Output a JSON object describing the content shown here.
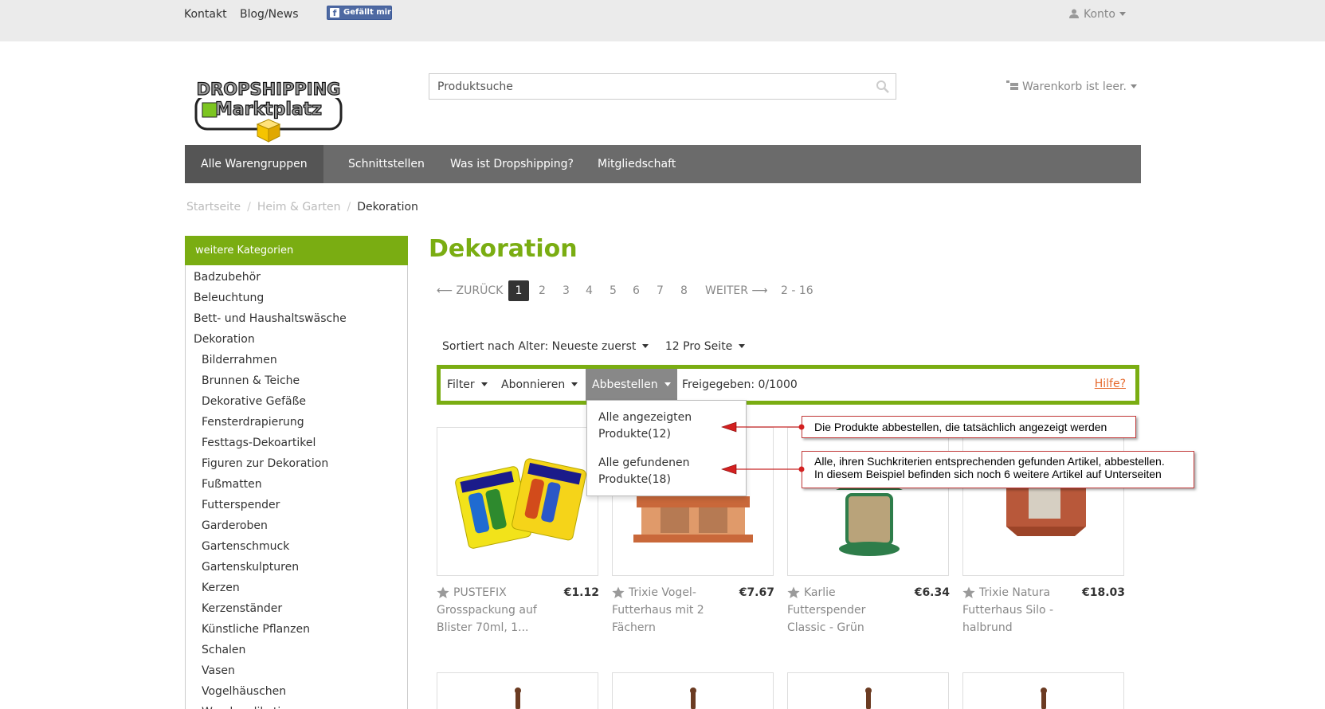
{
  "topbar": {
    "links": [
      "Kontakt",
      "Blog/News"
    ],
    "fb_like": "Gefällt mir",
    "account": "Konto"
  },
  "logo": {
    "line1": "DROPSHIPPING",
    "line2": "Marktplatz"
  },
  "search": {
    "placeholder": "Produktsuche"
  },
  "cart": {
    "label": "Warenkorb ist leer."
  },
  "nav": {
    "items": [
      "Alle Warengruppen",
      "Schnittstellen",
      "Was ist Dropshipping?",
      "Mitgliedschaft"
    ]
  },
  "breadcrumb": {
    "items": [
      "Startseite",
      "Heim & Garten",
      "Dekoration"
    ]
  },
  "sidebar": {
    "title": "weitere Kategorien",
    "categories": [
      "Badzubehör",
      "Beleuchtung",
      "Bett- und Haushaltswäsche",
      "Dekoration"
    ],
    "subcategories": [
      "Bilderrahmen",
      "Brunnen & Teiche",
      "Dekorative Gefäße",
      "Fensterdrapierung",
      "Festtags-Dekoartikel",
      "Figuren zur Dekoration",
      "Fußmatten",
      "Futterspender",
      "Garderoben",
      "Gartenschmuck",
      "Gartenskulpturen",
      "Kerzen",
      "Kerzenständer",
      "Künstliche Pflanzen",
      "Schalen",
      "Vasen",
      "Vogelhäuschen",
      "Wandapplikationen"
    ]
  },
  "page": {
    "title": "Dekoration"
  },
  "pagination": {
    "prev": "⟵ ZURÜCK",
    "pages": [
      "1",
      "2",
      "3",
      "4",
      "5",
      "6",
      "7",
      "8"
    ],
    "current": "1",
    "next": "WEITER ⟶",
    "range": "2 - 16"
  },
  "sort": {
    "sort_label": "Sortiert nach Alter: Neueste zuerst",
    "per_page": "12 Pro Seite"
  },
  "actionbar": {
    "filter": "Filter",
    "subscribe": "Abonnieren",
    "unsubscribe": "Abbestellen",
    "approved": "Freigegeben: 0/1000",
    "help": "Hilfe?"
  },
  "dropdown": {
    "item1": "Alle angezeigten Produkte(12)",
    "item2": "Alle gefundenen Produkte(18)"
  },
  "callouts": {
    "c1": "Die Produkte abbestellen, die tatsächlich angezeigt werden",
    "c2_line1": "Alle, ihren Suchkriterien entsprechenden gefunden Artikel, abbestellen.",
    "c2_line2": "In diesem Beispiel befinden sich noch 6 weitere Artikel auf Unterseiten"
  },
  "products": [
    {
      "title": "PUSTEFIX Grosspackung auf Blister 70ml, 1...",
      "price": "€1.12"
    },
    {
      "title": "Trixie Vogel-Futterhaus mit 2 Fächern",
      "price": "€7.67"
    },
    {
      "title": "Karlie Futterspender Classic - Grün",
      "price": "€6.34"
    },
    {
      "title": "Trixie Natura Futterhaus Silo - halbrund",
      "price": "€18.03"
    }
  ],
  "colors": {
    "accent_green": "#7aad12",
    "nav_gray": "#6b6b6b",
    "help_orange": "#e6692c",
    "callout_red": "#c23b3b"
  }
}
